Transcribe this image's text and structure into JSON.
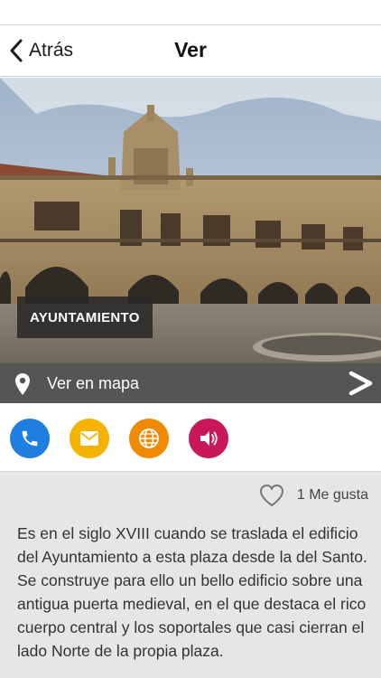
{
  "nav": {
    "back_label": "Atrás",
    "title": "Ver"
  },
  "place": {
    "name": "AYUNTAMIENTO"
  },
  "map": {
    "label": "Ver en mapa"
  },
  "actions": [
    {
      "name": "phone",
      "icon": "phone-icon",
      "color": "#1e7fe0"
    },
    {
      "name": "email",
      "icon": "mail-icon",
      "color": "#f5b300"
    },
    {
      "name": "web",
      "icon": "globe-icon",
      "color": "#f08a00"
    },
    {
      "name": "audio",
      "icon": "speaker-icon",
      "color": "#c8185a"
    }
  ],
  "likes": {
    "label": "1 Me gusta"
  },
  "description": "Es en el siglo XVIII cuando se traslada el edificio del Ayuntamiento a esta plaza desde la del Santo. Se construye para ello un bello edificio sobre una antigua puerta medieval, en el que destaca el rico cuerpo central y los soportales que casi cierran el lado Norte de la propia plaza."
}
